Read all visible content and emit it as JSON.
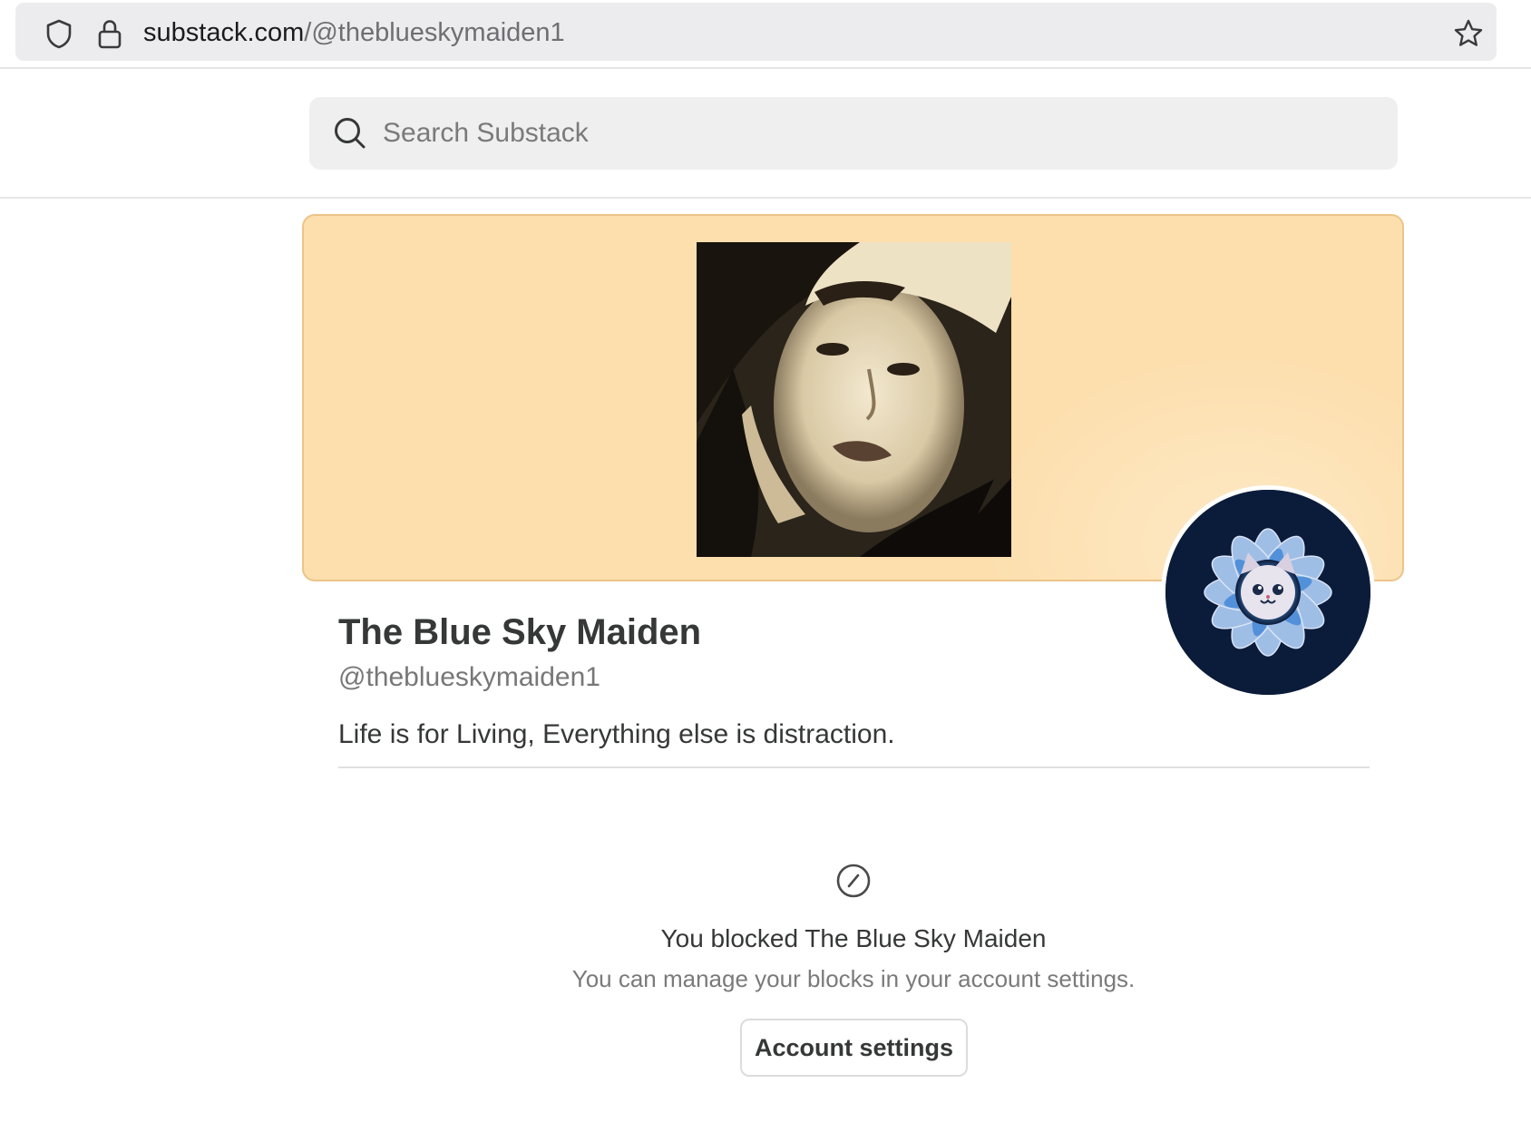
{
  "browser": {
    "url_host": "substack.com",
    "url_path": "/@theblueskymaiden1",
    "icons": [
      "shield-icon",
      "lock-icon",
      "star-icon"
    ]
  },
  "search": {
    "placeholder": "Search Substack",
    "icon": "search-icon"
  },
  "profile": {
    "name": "The Blue Sky Maiden",
    "handle": "@theblueskymaiden1",
    "bio": "Life is for Living, Everything else is distraction.",
    "banner_color": "#fddfae",
    "banner_border": "#ecc489"
  },
  "blocked": {
    "icon": "blocked-icon",
    "title": "You blocked The Blue Sky Maiden",
    "subtitle": "You can manage your blocks in your account settings.",
    "button_label": "Account settings"
  }
}
